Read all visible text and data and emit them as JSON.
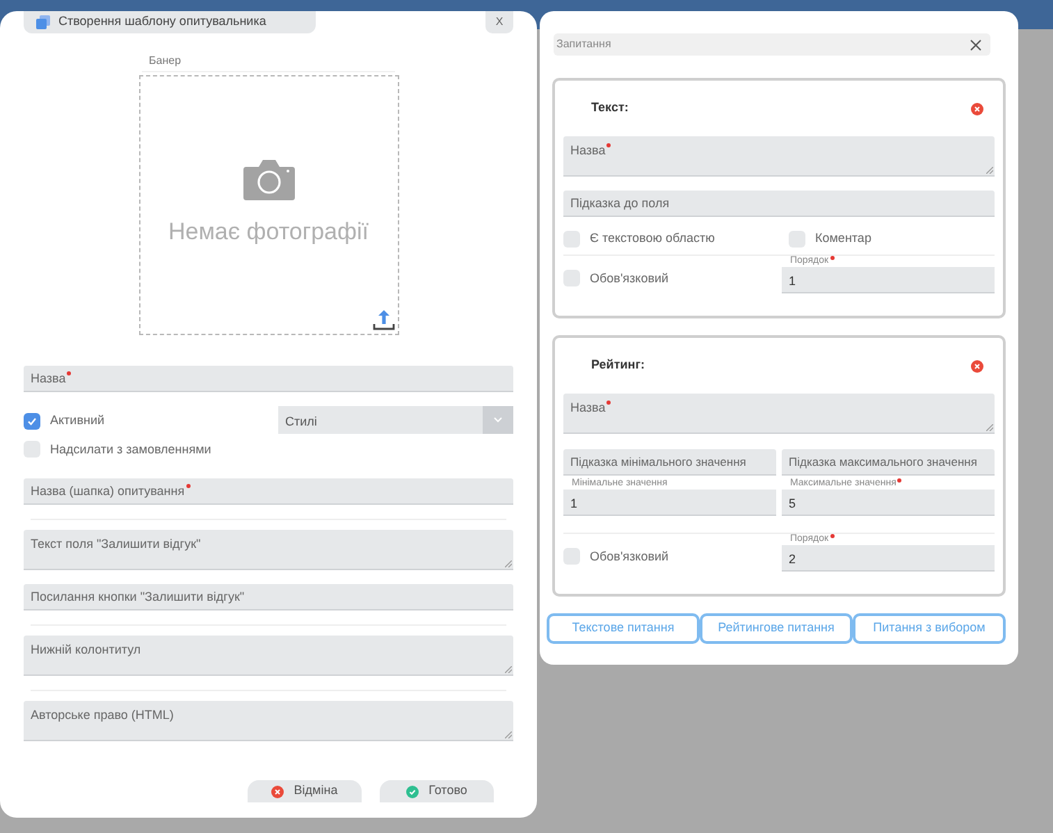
{
  "template_dialog": {
    "title": "Створення шаблону опитувальника",
    "close": "X",
    "banner": {
      "label": "Банер",
      "placeholder": "Немає фотографії"
    },
    "name_field": {
      "placeholder": "Назва",
      "required": true
    },
    "checkboxes": [
      {
        "label": "Активний",
        "checked": true
      },
      {
        "label": "Надсилати з замовленнями",
        "checked": false
      }
    ],
    "style_select": {
      "value": "Стилі"
    },
    "fields": [
      {
        "kind": "input",
        "placeholder": "Назва (шапка) опитування",
        "required": true
      },
      {
        "kind": "textarea",
        "placeholder": "Текст поля \"Залишити відгук\"",
        "required": false
      },
      {
        "kind": "input",
        "placeholder": "Посилання кнопки \"Залишити відгук\"",
        "required": false
      },
      {
        "kind": "textarea",
        "placeholder": "Нижній колонтитул",
        "required": false
      },
      {
        "kind": "textarea",
        "placeholder": "Авторське право (HTML)",
        "required": false
      }
    ],
    "buttons": [
      {
        "label": "Відміна",
        "kind": "cancel"
      },
      {
        "label": "Готово",
        "kind": "ok"
      }
    ]
  },
  "questions_dialog": {
    "title": "Запитання",
    "questions": [
      {
        "kind": "text",
        "title": "Текст:",
        "name": {
          "placeholder": "Назва",
          "required": true
        },
        "hint": {
          "placeholder": "Підказка до поля"
        },
        "textarea_checkbox": {
          "label": "Є текстовою областю",
          "checked": false
        },
        "comment_checkbox": {
          "label": "Коментар",
          "checked": false
        },
        "required_checkbox": {
          "label": "Обов'язковий",
          "checked": false
        },
        "order": {
          "label": "Порядок",
          "required": true,
          "value": "1"
        }
      },
      {
        "kind": "rating",
        "title": "Рейтинг:",
        "name": {
          "placeholder": "Назва",
          "required": true
        },
        "min_hint": {
          "placeholder": "Підказка мінімального значення"
        },
        "max_hint": {
          "placeholder": "Підказка максимального значення"
        },
        "min_value": {
          "label": "Мінімальне значення",
          "required": false,
          "value": "1"
        },
        "max_value": {
          "label": "Максимальне значення",
          "required": true,
          "value": "5"
        },
        "required_checkbox": {
          "label": "Обов'язковий",
          "checked": false
        },
        "order": {
          "label": "Порядок",
          "required": true,
          "value": "2"
        }
      }
    ],
    "add_buttons": [
      "Текстове питання",
      "Рейтингове питання",
      "Питання з вибором"
    ]
  }
}
